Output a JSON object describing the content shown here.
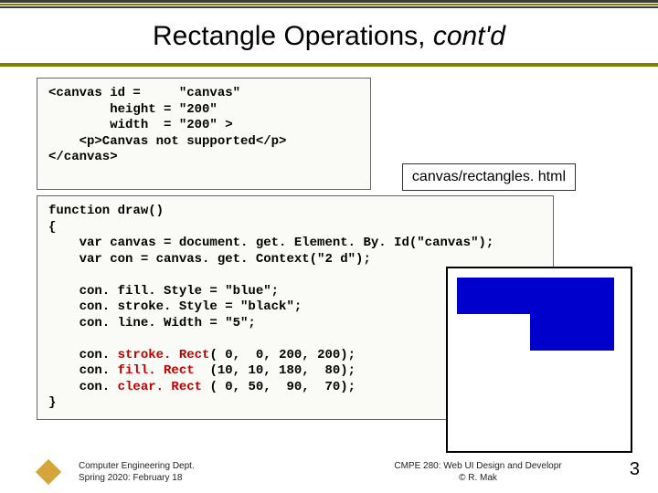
{
  "header": {
    "title_main": "Rectangle Operations, ",
    "title_cont": "cont'd"
  },
  "code1": {
    "l1": "<canvas id =     \"canvas\"",
    "l2": "        height = \"200\"",
    "l3": "        width  = \"200\" >",
    "l4": "    <p>Canvas not supported</p>",
    "l5": "</canvas>"
  },
  "file_label": "canvas/rectangles. html",
  "code2": {
    "l1": "function draw()",
    "l2": "{",
    "l3": "    var canvas = document. get. Element. By. Id(\"canvas\");",
    "l4": "    var con = canvas. get. Context(\"2 d\");",
    "l5": "",
    "l6": "    con. fill. Style = \"blue\";",
    "l7": "    con. stroke. Style = \"black\";",
    "l8": "    con. line. Width = \"5\";",
    "l9": "",
    "l10a": "    con. ",
    "l10b": "stroke. Rect",
    "l10c": "( 0,  0, 200, 200);",
    "l11a": "    con. ",
    "l11b": "fill. Rect",
    "l11c": "  (10, 10, 180,  80);",
    "l12a": "    con. ",
    "l12b": "clear. Rect",
    "l12c": " ( 0, 50,  90,  70);",
    "l13": "}"
  },
  "footer": {
    "left_line1": "Computer Engineering Dept.",
    "left_line2": "Spring 2020: February 18",
    "center_line1": "CMPE 280: Web UI Design and Developr",
    "center_line2": "© R. Mak"
  },
  "page_number": "3"
}
